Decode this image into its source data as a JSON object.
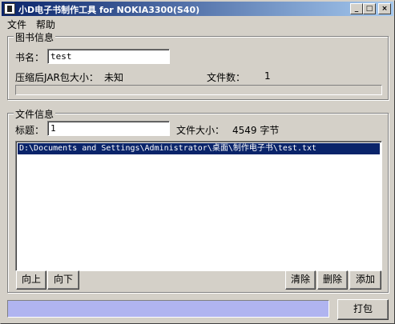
{
  "window": {
    "title": "小D电子书制作工具 for NOKIA3300(S40)",
    "controls": {
      "minimize": "_",
      "maximize": "□",
      "close": "×"
    }
  },
  "menu": [
    "文件",
    "帮助"
  ],
  "book_info": {
    "group_title": "图书信息",
    "book_name_label": "书名：",
    "book_name_value": "test",
    "jar_size_label": "压缩后JAR包大小：",
    "jar_size_value": "未知",
    "file_count_label": "文件数：",
    "file_count_value": "1",
    "progress_fraction": 0.0
  },
  "file_info": {
    "group_title": "文件信息",
    "title_label": "标题：",
    "title_value": "1",
    "file_size_label": "文件大小：",
    "file_size_value": "4549 字节",
    "files": [
      {
        "path": "D:\\Documents and Settings\\Administrator\\桌面\\制作电子书\\test.txt",
        "selected": true
      }
    ],
    "buttons": {
      "move_up": "向上",
      "move_down": "向下",
      "clear": "清除",
      "delete": "删除",
      "add": "添加"
    }
  },
  "bottom": {
    "status_text": "",
    "pack_button": "打包"
  },
  "colors": {
    "title_gradient_start": "#0a246a",
    "title_gradient_end": "#a6caf0",
    "selection": "#0a246a",
    "status_box": "#b0b4f0"
  }
}
